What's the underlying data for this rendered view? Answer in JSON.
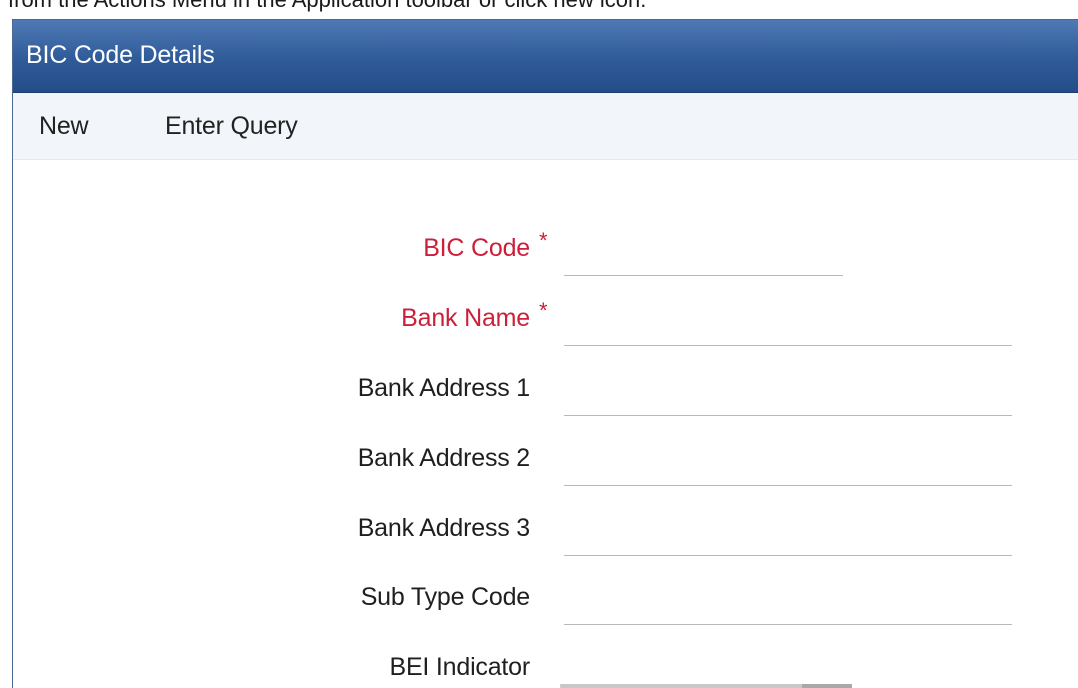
{
  "caption": "from the Actions Menu in the Application toolbar or click new icon.",
  "window": {
    "title": "BIC Code Details"
  },
  "toolbar": {
    "new_label": "New",
    "enter_query_label": "Enter Query"
  },
  "form": {
    "required_marker": "*",
    "fields": [
      {
        "label": "BIC Code",
        "required": true,
        "value": ""
      },
      {
        "label": "Bank Name",
        "required": true,
        "value": ""
      },
      {
        "label": "Bank Address 1",
        "required": false,
        "value": ""
      },
      {
        "label": "Bank Address 2",
        "required": false,
        "value": ""
      },
      {
        "label": "Bank Address 3",
        "required": false,
        "value": ""
      },
      {
        "label": "Sub Type Code",
        "required": false,
        "value": ""
      },
      {
        "label": "BEI Indicator",
        "required": false,
        "value": ""
      }
    ]
  },
  "colors": {
    "title_bar": "#2f5b99",
    "required_label": "#cc1f3a",
    "toolbar_bg": "#f2f6fb"
  }
}
